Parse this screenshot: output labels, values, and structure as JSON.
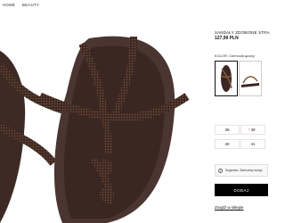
{
  "nav": {
    "home": "HOME",
    "beauty": "BEAUTY"
  },
  "product": {
    "name": "SANDAŁY ZDOBIONE STRA",
    "price": "127,99 PLN",
    "color_label": "KOLOR: Ciemnobrązowy",
    "colors": {
      "strap": "#3a2722",
      "strap_dark": "#231612",
      "sole": "#4a3530",
      "beads": "#8a5a3c"
    }
  },
  "sizes": [
    {
      "label": "36",
      "low_stock": false
    },
    {
      "label": "39",
      "low_stock": false
    },
    {
      "label": "40",
      "low_stock": false
    },
    {
      "label": "41",
      "low_stock": false
    }
  ],
  "low_stock_marker": "•",
  "info": {
    "icon": "i",
    "text": "Sugestia: Zalecamy wziąć"
  },
  "actions": {
    "add_label": "DODAJ",
    "store_link": "Znajdź w sklepie"
  }
}
